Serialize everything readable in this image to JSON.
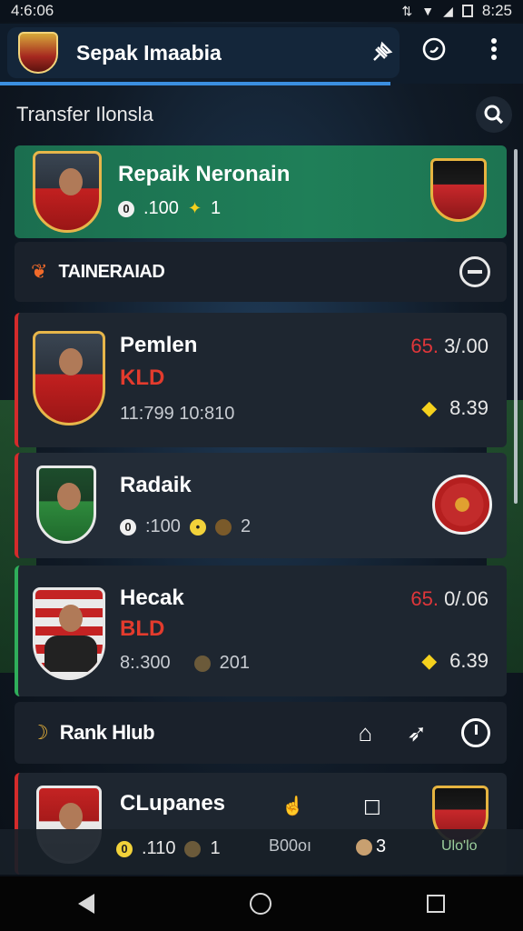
{
  "status_bar": {
    "time_left": "4:6:06",
    "time_right": "8:25"
  },
  "app_bar": {
    "title": "Sepak Imaabia"
  },
  "section": {
    "title": "Transfer Ilonsla"
  },
  "featured": {
    "name": "Repaik Neronain",
    "stat1": ".100",
    "stat2": "1"
  },
  "filter_bar": {
    "label": "TAINERAIAD"
  },
  "players": [
    {
      "name": "Pemlen",
      "code": "KLD",
      "stats": "11:799  10:810",
      "value_hi": "65.",
      "value_rest": " 3/.00",
      "rating": "8.39"
    },
    {
      "name": "Radaik",
      "stat1": ":100",
      "stat2": "2"
    },
    {
      "name": "Hecak",
      "code": "BLD",
      "stat1": "8:.300",
      "stat2": "201",
      "value_hi": "65.",
      "value_rest": " 0/.06",
      "rating": "6.39"
    }
  ],
  "rank_bar": {
    "label": "Rank Hlub"
  },
  "bottom_card": {
    "name": "CLupanes",
    "stat1": ".110",
    "stat2": "1",
    "tab1": "B00oı",
    "tab2": "3",
    "tab3": "Ulo'lo"
  }
}
